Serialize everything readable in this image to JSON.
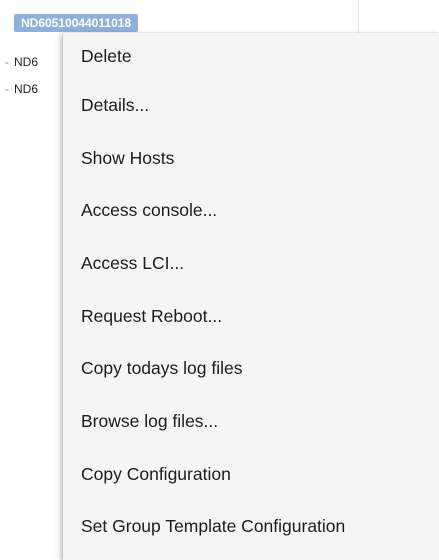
{
  "tree": {
    "items": [
      {
        "label": "ND60510044011018",
        "selected": true
      },
      {
        "label": "ND6"
      },
      {
        "label": "ND6"
      }
    ]
  },
  "context_menu": {
    "items": [
      {
        "label": "Delete"
      },
      {
        "label": "Details..."
      },
      {
        "label": "Show Hosts"
      },
      {
        "label": "Access console..."
      },
      {
        "label": "Access LCI..."
      },
      {
        "label": "Request Reboot..."
      },
      {
        "label": "Copy todays log files"
      },
      {
        "label": "Browse log files..."
      },
      {
        "label": "Copy Configuration"
      },
      {
        "label": "Set Group Template Configuration"
      }
    ]
  },
  "colors": {
    "selection": "#8fb0d8",
    "menu_background": "#f5f5f5"
  }
}
